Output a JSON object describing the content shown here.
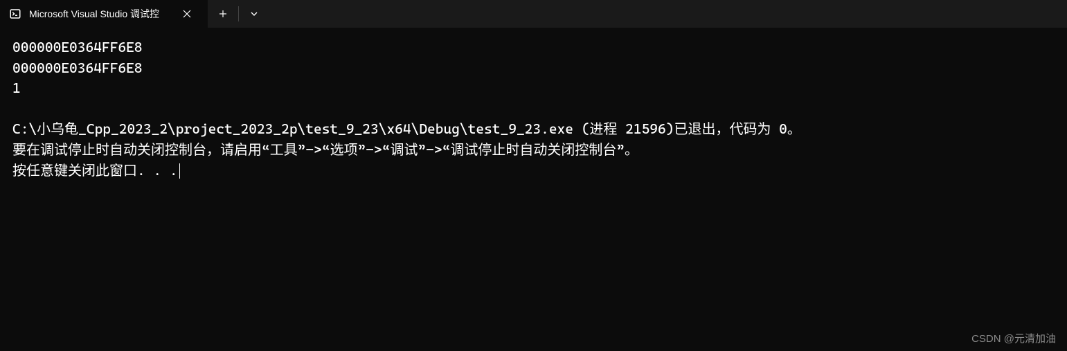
{
  "tab": {
    "title": "Microsoft Visual Studio 调试控"
  },
  "console": {
    "lines": [
      "000000E0364FF6E8",
      "000000E0364FF6E8",
      "1",
      "",
      "C:\\小乌龟_Cpp_2023_2\\project_2023_2p\\test_9_23\\x64\\Debug\\test_9_23.exe (进程 21596)已退出，代码为 0。",
      "要在调试停止时自动关闭控制台，请启用“工具”->“选项”->“调试”->“调试停止时自动关闭控制台”。",
      "按任意键关闭此窗口. . ."
    ]
  },
  "watermark": "CSDN @元清加油"
}
